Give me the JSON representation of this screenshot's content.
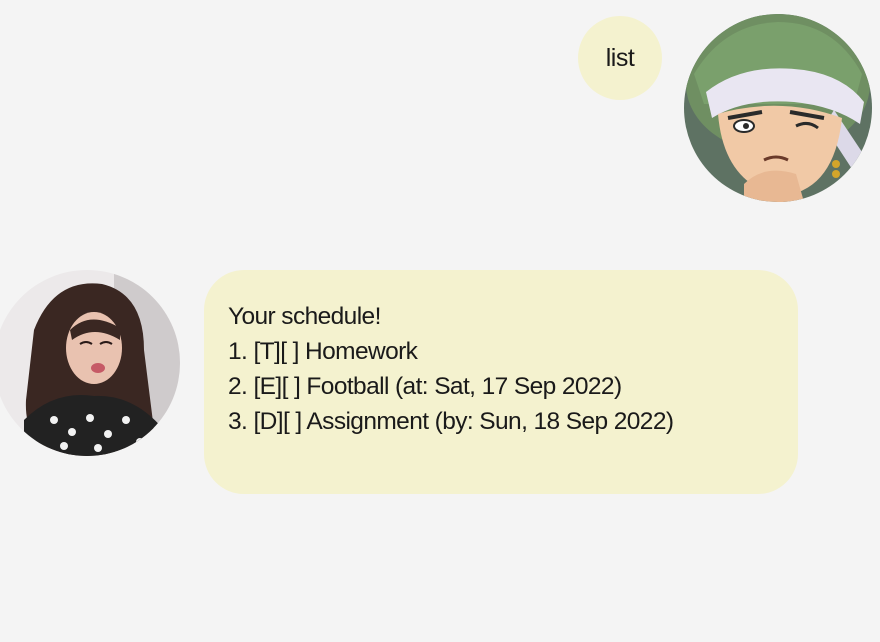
{
  "conversation": {
    "user_message": {
      "text": "list",
      "avatar_icon": "user-avatar-anime-character",
      "bubble_color": "#f4f2cf"
    },
    "bot_message": {
      "avatar_icon": "bot-avatar-portrait-photo",
      "bubble_color": "#f4f2cf",
      "lines": [
        "Your schedule!",
        "1. [T][ ] Homework",
        "2. [E][ ] Football (at: Sat, 17 Sep 2022)",
        "3. [D][ ] Assignment (by: Sun, 18 Sep 2022)"
      ]
    }
  },
  "colors": {
    "background": "#f4f4f4",
    "bubble": "#f4f2cf"
  }
}
